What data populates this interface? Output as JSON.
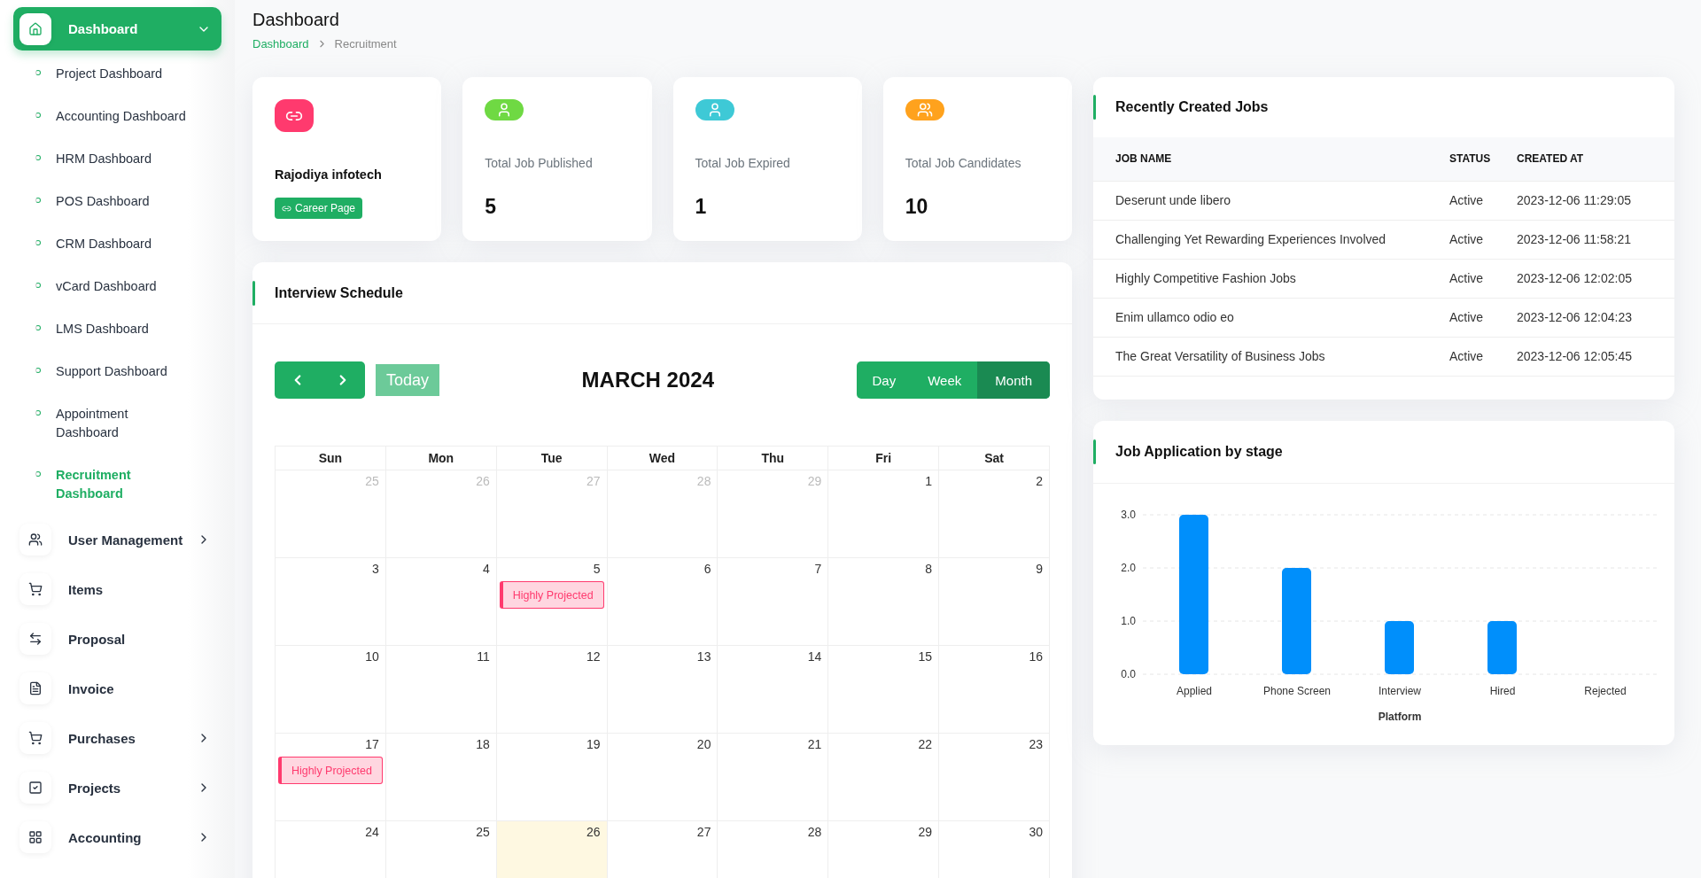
{
  "sidebar": {
    "items": [
      {
        "label": "Dashboard",
        "selected": true,
        "expandable": true,
        "expanded": true,
        "children": [
          {
            "label": "Project Dashboard",
            "selected": false
          },
          {
            "label": "Accounting Dashboard",
            "selected": false
          },
          {
            "label": "HRM Dashboard",
            "selected": false
          },
          {
            "label": "POS Dashboard",
            "selected": false
          },
          {
            "label": "CRM Dashboard",
            "selected": false
          },
          {
            "label": "vCard Dashboard",
            "selected": false
          },
          {
            "label": "LMS Dashboard",
            "selected": false
          },
          {
            "label": "Support Dashboard",
            "selected": false
          },
          {
            "label": "Appointment Dashboard",
            "selected": false
          },
          {
            "label": "Recruitment Dashboard",
            "selected": true
          }
        ]
      },
      {
        "label": "User Management",
        "selected": false,
        "expandable": true,
        "expanded": false
      },
      {
        "label": "Items",
        "selected": false,
        "expandable": false
      },
      {
        "label": "Proposal",
        "selected": false,
        "expandable": false
      },
      {
        "label": "Invoice",
        "selected": false,
        "expandable": false
      },
      {
        "label": "Purchases",
        "selected": false,
        "expandable": true,
        "expanded": false
      },
      {
        "label": "Projects",
        "selected": false,
        "expandable": true,
        "expanded": false
      },
      {
        "label": "Accounting",
        "selected": false,
        "expandable": true,
        "expanded": false
      }
    ]
  },
  "page": {
    "title": "Dashboard",
    "breadcrumb": [
      {
        "label": "Dashboard",
        "link": true
      },
      {
        "label": "Recruitment",
        "link": false
      }
    ]
  },
  "cards": [
    {
      "kind": "company",
      "color": "#ff3a6e",
      "name": "Rajodiya infotech",
      "button": "Career Page"
    },
    {
      "kind": "stat",
      "color": "#6fd943",
      "label": "Total Job Published",
      "value": "5"
    },
    {
      "kind": "stat",
      "color": "#3ec9d6",
      "label": "Total Job Expired",
      "value": "1"
    },
    {
      "kind": "stat",
      "color": "#ffa21d",
      "label": "Total Job Candidates",
      "value": "10"
    }
  ],
  "interview_schedule": {
    "title": "Interview Schedule",
    "today_button": {
      "label": "Today",
      "disabled": true
    },
    "month": "MARCH 2024",
    "views": [
      {
        "label": "Day",
        "selected": false
      },
      {
        "label": "Week",
        "selected": false
      },
      {
        "label": "Month",
        "selected": true
      }
    ],
    "weekdays": [
      "Sun",
      "Mon",
      "Tue",
      "Wed",
      "Thu",
      "Fri",
      "Sat"
    ],
    "weeks": [
      [
        {
          "day": "25",
          "other_month": true,
          "today": false
        },
        {
          "day": "26",
          "other_month": true,
          "today": false
        },
        {
          "day": "27",
          "other_month": true,
          "today": false
        },
        {
          "day": "28",
          "other_month": true,
          "today": false
        },
        {
          "day": "29",
          "other_month": true,
          "today": false
        },
        {
          "day": "1",
          "other_month": false,
          "today": false
        },
        {
          "day": "2",
          "other_month": false,
          "today": false
        }
      ],
      [
        {
          "day": "3",
          "other_month": false,
          "today": false
        },
        {
          "day": "4",
          "other_month": false,
          "today": false
        },
        {
          "day": "5",
          "other_month": false,
          "today": false,
          "events": [
            "Highly Projected"
          ]
        },
        {
          "day": "6",
          "other_month": false,
          "today": false
        },
        {
          "day": "7",
          "other_month": false,
          "today": false
        },
        {
          "day": "8",
          "other_month": false,
          "today": false
        },
        {
          "day": "9",
          "other_month": false,
          "today": false
        }
      ],
      [
        {
          "day": "10",
          "other_month": false,
          "today": false
        },
        {
          "day": "11",
          "other_month": false,
          "today": false
        },
        {
          "day": "12",
          "other_month": false,
          "today": false
        },
        {
          "day": "13",
          "other_month": false,
          "today": false
        },
        {
          "day": "14",
          "other_month": false,
          "today": false
        },
        {
          "day": "15",
          "other_month": false,
          "today": false
        },
        {
          "day": "16",
          "other_month": false,
          "today": false
        }
      ],
      [
        {
          "day": "17",
          "other_month": false,
          "today": false,
          "events": [
            "Highly Projected"
          ]
        },
        {
          "day": "18",
          "other_month": false,
          "today": false
        },
        {
          "day": "19",
          "other_month": false,
          "today": false
        },
        {
          "day": "20",
          "other_month": false,
          "today": false
        },
        {
          "day": "21",
          "other_month": false,
          "today": false
        },
        {
          "day": "22",
          "other_month": false,
          "today": false
        },
        {
          "day": "23",
          "other_month": false,
          "today": false
        }
      ],
      [
        {
          "day": "24",
          "other_month": false,
          "today": false
        },
        {
          "day": "25",
          "other_month": false,
          "today": false
        },
        {
          "day": "26",
          "other_month": false,
          "today": true
        },
        {
          "day": "27",
          "other_month": false,
          "today": false
        },
        {
          "day": "28",
          "other_month": false,
          "today": false
        },
        {
          "day": "29",
          "other_month": false,
          "today": false
        },
        {
          "day": "30",
          "other_month": false,
          "today": false
        }
      ]
    ]
  },
  "recent_jobs": {
    "title": "Recently Created Jobs",
    "columns": [
      "JOB NAME",
      "STATUS",
      "CREATED AT"
    ],
    "rows": [
      [
        "Deserunt unde libero",
        "Active",
        "2023-12-06 11:29:05"
      ],
      [
        "Challenging Yet Rewarding Experiences Involved",
        "Active",
        "2023-12-06 11:58:21"
      ],
      [
        "Highly Competitive Fashion Jobs",
        "Active",
        "2023-12-06 12:02:05"
      ],
      [
        "Enim ullamco odio eo",
        "Active",
        "2023-12-06 12:04:23"
      ],
      [
        "The Great Versatility of Business Jobs",
        "Active",
        "2023-12-06 12:05:45"
      ]
    ]
  },
  "applications_chart": {
    "title": "Job Application by stage",
    "chart_data": {
      "type": "bar",
      "xlabel": "Platform",
      "categories": [
        "Applied",
        "Phone Screen",
        "Interview",
        "Hired",
        "Rejected"
      ],
      "values": [
        3,
        2,
        1,
        1,
        0
      ],
      "ylim": [
        0,
        3
      ],
      "yticks": [
        {
          "value": 0,
          "label": "0.0"
        },
        {
          "value": 1,
          "label": "1.0"
        },
        {
          "value": 2,
          "label": "2.0"
        },
        {
          "value": 3,
          "label": "3.0"
        }
      ]
    }
  }
}
